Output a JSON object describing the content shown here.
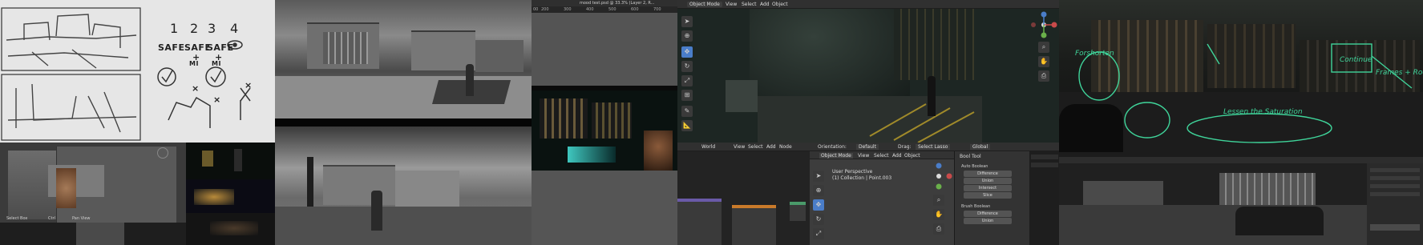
{
  "sketch": {
    "numbers": [
      "1",
      "2",
      "3",
      "4"
    ],
    "notes": [
      "SAFE",
      "SAFE",
      "SAFE"
    ],
    "plus": [
      "+",
      "+"
    ],
    "sub_notes": [
      "MI",
      "MI"
    ],
    "marks": [
      "✓",
      "✓",
      "×",
      "×",
      "×"
    ]
  },
  "photoshop": {
    "tab_title": "mood test.psd @ 33.3% (Layer 2, R...",
    "ruler_ticks": [
      "00",
      "200",
      "300",
      "400",
      "500",
      "600",
      "700"
    ]
  },
  "blender_thumb": {
    "status_left": "Select Box",
    "status_mid": "Ctrl",
    "status_right": "Pan View"
  },
  "viewport_header": {
    "mode": "Object Mode",
    "menus": [
      "View",
      "Select",
      "Add",
      "Object"
    ]
  },
  "node_header": {
    "editor": "World",
    "menus": [
      "View",
      "Select",
      "Add",
      "Node"
    ]
  },
  "tool_header": {
    "orientation_label": "Orientation:",
    "orientation_value": "Default",
    "drag_label": "Drag:",
    "drag_value": "Select Lasso",
    "transform_value": "Global"
  },
  "viewport2": {
    "mode": "Object Mode",
    "menus": [
      "View",
      "Select",
      "Add",
      "Object"
    ],
    "title": "User Perspective",
    "subtitle": "(1) Collection | Point.003"
  },
  "bool_tool": {
    "title": "Bool Tool",
    "auto_label": "Auto Boolean",
    "auto_buttons": [
      "Difference",
      "Union",
      "Intersect",
      "Slice"
    ],
    "brush_label": "Brush Boolean",
    "brush_buttons": [
      "Difference",
      "Union"
    ]
  },
  "paintover_notes": [
    "Forshorten",
    "Continue",
    "Frames + Roofs",
    "Lessen the Saturation"
  ],
  "colors": {
    "blender_active": "#4a7dc9",
    "ink": "#3fd49a",
    "node_orange": "#c97a2a",
    "node_purple": "#6a5aa8"
  }
}
